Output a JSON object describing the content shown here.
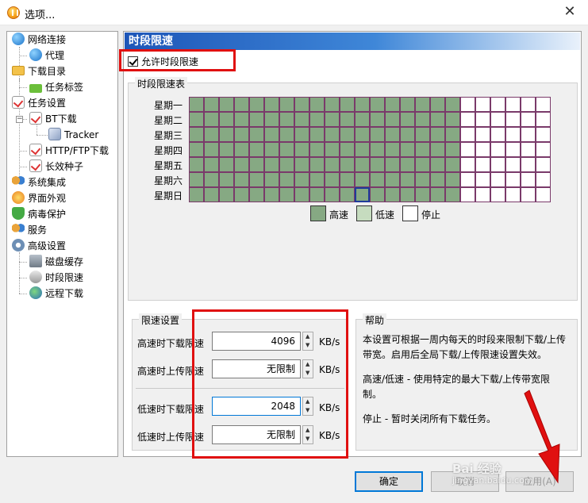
{
  "window": {
    "title": "选项...",
    "close_glyph": "✕"
  },
  "tree": {
    "items": [
      {
        "label": "网络连接",
        "icon": "globe-icon"
      },
      {
        "label": "代理",
        "icon": "globe-icon"
      },
      {
        "label": "下载目录",
        "icon": "folder-icon"
      },
      {
        "label": "任务标签",
        "icon": "tag-icon"
      },
      {
        "label": "任务设置",
        "icon": "task-icon"
      },
      {
        "label": "BT下载",
        "icon": "task-icon"
      },
      {
        "label": "Tracker",
        "icon": "cube-icon"
      },
      {
        "label": "HTTP/FTP下载",
        "icon": "task-icon"
      },
      {
        "label": "长效种子",
        "icon": "task-icon"
      },
      {
        "label": "系统集成",
        "icon": "people-icon"
      },
      {
        "label": "界面外观",
        "icon": "palette-icon"
      },
      {
        "label": "病毒保护",
        "icon": "shield-icon"
      },
      {
        "label": "服务",
        "icon": "people-icon"
      },
      {
        "label": "高级设置",
        "icon": "gear-icon"
      },
      {
        "label": "磁盘缓存",
        "icon": "disk-icon"
      },
      {
        "label": "时段限速",
        "icon": "plug-icon"
      },
      {
        "label": "远程下载",
        "icon": "earth-icon"
      }
    ]
  },
  "panel": {
    "header": "时段限速",
    "enable_label": "允许时段限速",
    "enable_checked": true
  },
  "schedule": {
    "group_title": "时段限速表",
    "days": [
      "星期一",
      "星期二",
      "星期三",
      "星期四",
      "星期五",
      "星期六",
      "星期日"
    ],
    "hours_per_row": 24,
    "high_speed_hours": 18,
    "selected_cell": {
      "day": 6,
      "hour": 11
    },
    "colors": {
      "high": "#86a983",
      "low": "#c6dcbf",
      "stop": "#ffffff",
      "selected": "#1f3b9a"
    },
    "legend": [
      {
        "label": "高速",
        "key": "high"
      },
      {
        "label": "低速",
        "key": "low"
      },
      {
        "label": "停止",
        "key": "stop"
      }
    ]
  },
  "limits": {
    "group_title": "限速设置",
    "unit": "KB/s",
    "high_download": {
      "label": "高速时下载限速",
      "value": "4096"
    },
    "high_upload": {
      "label": "高速时上传限速",
      "value": "无限制"
    },
    "low_download": {
      "label": "低速时下载限速",
      "value": "2048"
    },
    "low_upload": {
      "label": "低速时上传限速",
      "value": "无限制"
    }
  },
  "help": {
    "title": "帮助",
    "para1_line1": "本设置可根据一周内每天的时段来限制下载/上传",
    "para1_line2": "带宽。启用后全局下载/上传限速设置失效。",
    "para2_line1": "高速/低速 - 使用特定的最大下载/上传带宽限",
    "para2_line2": "制。",
    "para3": "停止 - 暂时关闭所有下载任务。"
  },
  "buttons": {
    "ok": "确定",
    "cancel": "取消",
    "apply": "应用(A)"
  },
  "watermark": {
    "brand": "Bai 经验",
    "url": "jingyan.baidu.com"
  },
  "annotation_color": "#e01010"
}
